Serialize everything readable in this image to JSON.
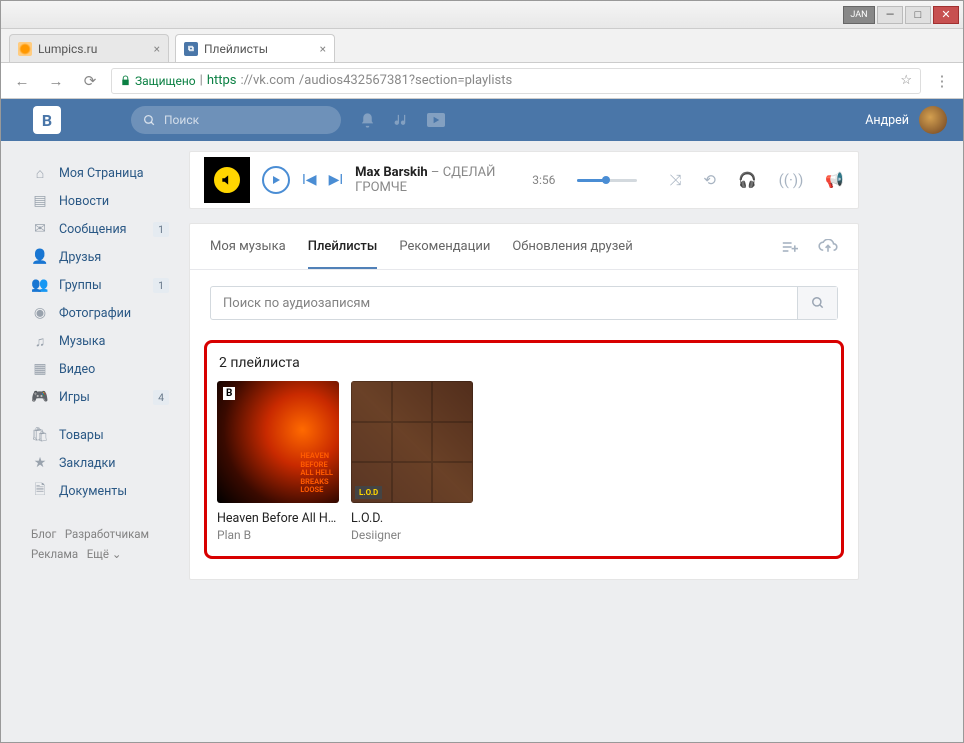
{
  "window": {
    "jan_label": "JAN",
    "minimize": "—",
    "maximize": "□",
    "close": "✕"
  },
  "tabs": [
    {
      "title": "Lumpics.ru",
      "active": false
    },
    {
      "title": "Плейлисты",
      "active": true
    }
  ],
  "url": {
    "secure_label": "Защищено",
    "protocol": "https",
    "host": "://vk.com",
    "path": "/audios432567381?section=playlists"
  },
  "vk_header": {
    "logo_letter": "B",
    "search_placeholder": "Поиск",
    "username": "Андрей"
  },
  "sidebar": {
    "items": [
      {
        "label": "Моя Страница",
        "icon": "home"
      },
      {
        "label": "Новости",
        "icon": "news"
      },
      {
        "label": "Сообщения",
        "icon": "msg",
        "badge": "1"
      },
      {
        "label": "Друзья",
        "icon": "friends"
      },
      {
        "label": "Группы",
        "icon": "groups",
        "badge": "1"
      },
      {
        "label": "Фотографии",
        "icon": "photo"
      },
      {
        "label": "Музыка",
        "icon": "music"
      },
      {
        "label": "Видео",
        "icon": "video"
      },
      {
        "label": "Игры",
        "icon": "games",
        "badge": "4"
      }
    ],
    "items2": [
      {
        "label": "Товары",
        "icon": "shop"
      },
      {
        "label": "Закладки",
        "icon": "bookmark"
      },
      {
        "label": "Документы",
        "icon": "docs"
      }
    ],
    "footer": {
      "blog": "Блог",
      "devs": "Разработчикам",
      "ads": "Реклама",
      "more": "Ещё ⌄"
    }
  },
  "player": {
    "artist": "Max Barskih",
    "sep": " – ",
    "track": "СДЕЛАЙ ГРОМЧЕ",
    "time": "3:56"
  },
  "music": {
    "tabs": [
      "Моя музыка",
      "Плейлисты",
      "Рекомендации",
      "Обновления друзей"
    ],
    "active_tab": 1,
    "search_placeholder": "Поиск по аудиозаписям",
    "playlists_heading": "2 плейлиста",
    "playlists": [
      {
        "title": "Heaven Before All Hell ...",
        "artist": "Plan B"
      },
      {
        "title": "L.O.D.",
        "artist": "Desiigner"
      }
    ]
  }
}
